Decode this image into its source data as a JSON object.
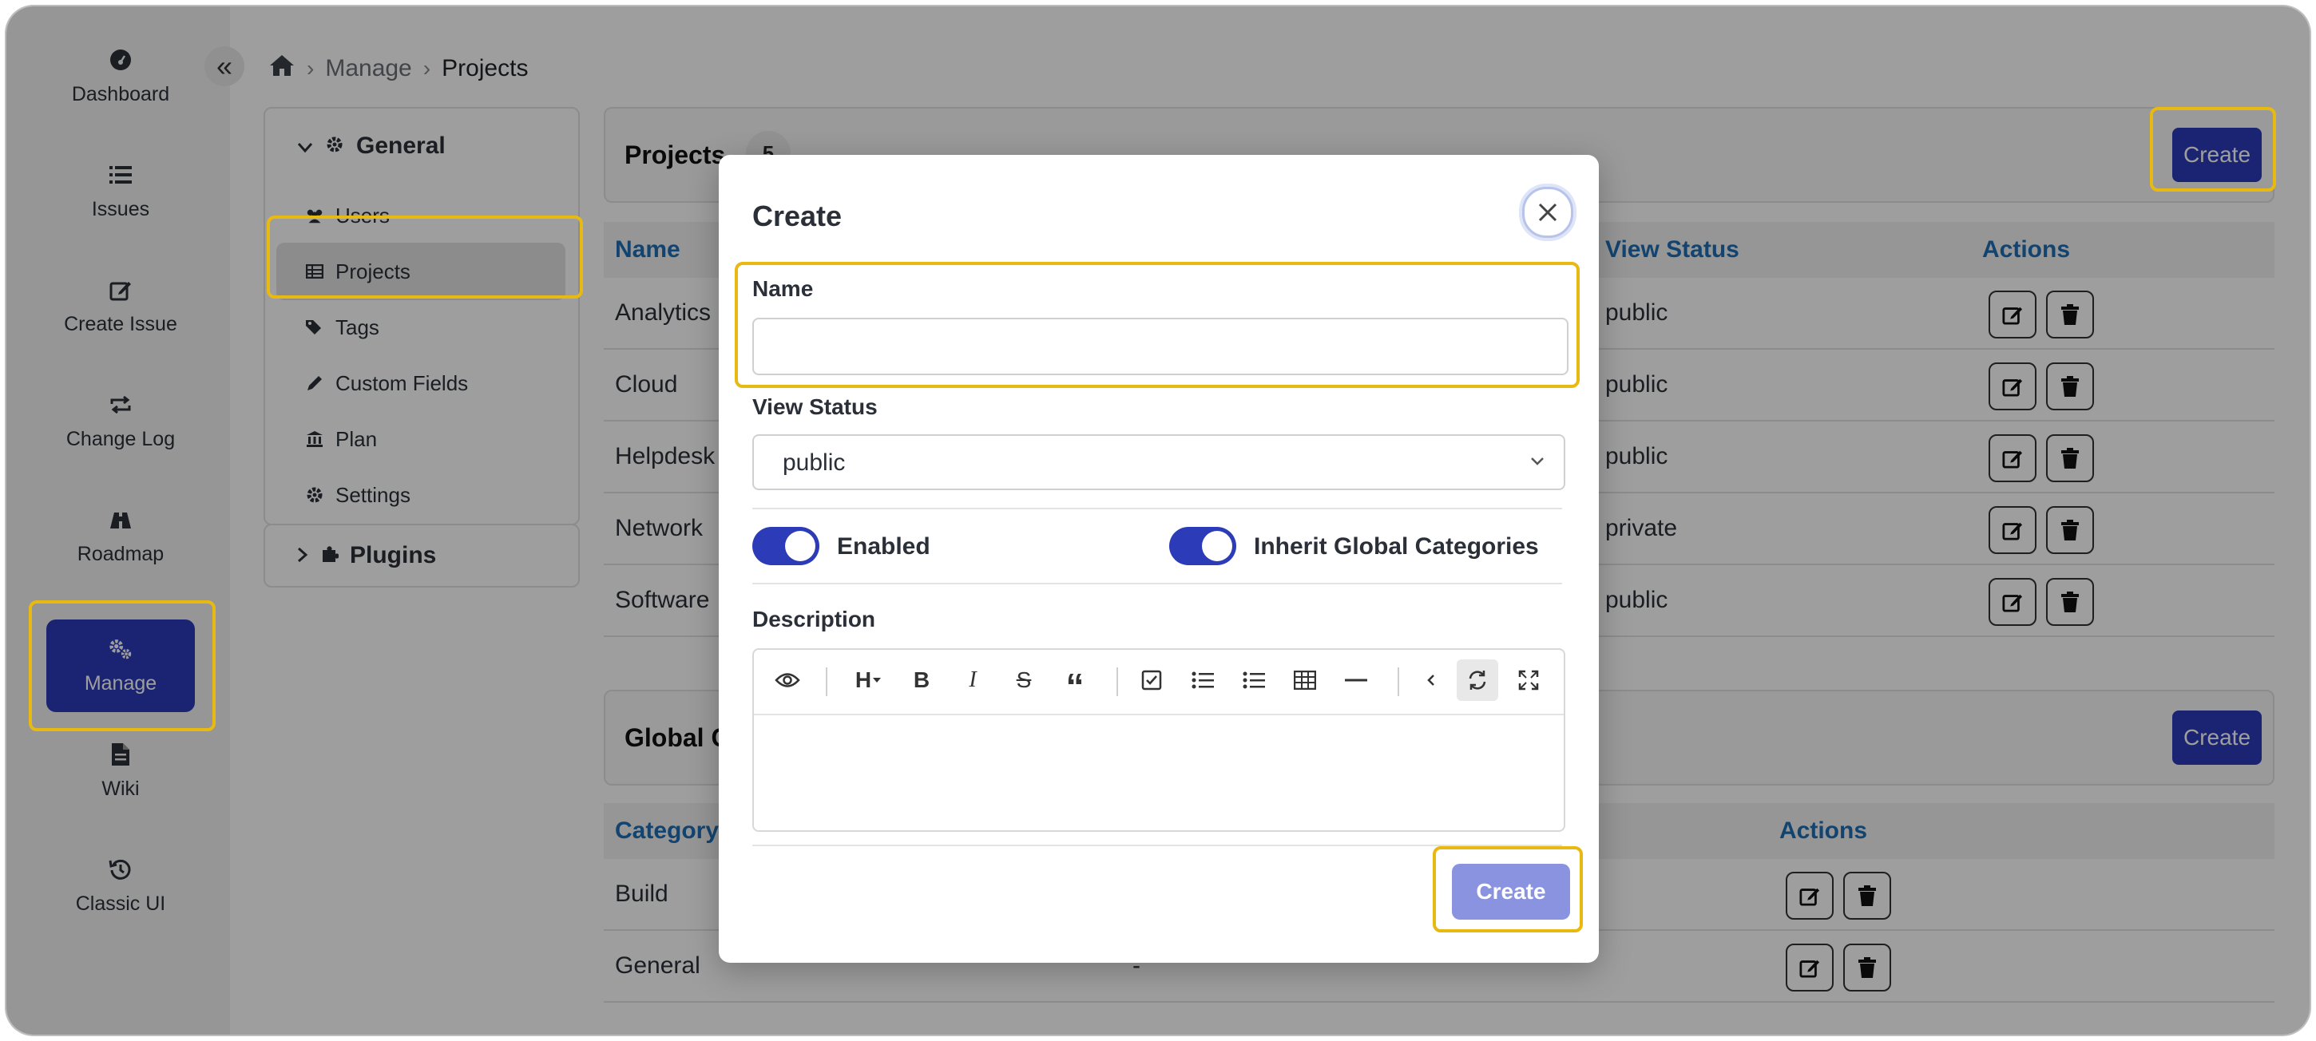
{
  "sidebar": {
    "collapse_glyph": "«",
    "items": [
      {
        "label": "Dashboard",
        "icon": "dashboard-icon"
      },
      {
        "label": "Issues",
        "icon": "list-icon"
      },
      {
        "label": "Create Issue",
        "icon": "edit-icon"
      },
      {
        "label": "Change Log",
        "icon": "repeat-icon"
      },
      {
        "label": "Roadmap",
        "icon": "binoculars-icon"
      },
      {
        "label": "Manage",
        "icon": "gears-icon",
        "active": true
      },
      {
        "label": "Wiki",
        "icon": "file-icon"
      },
      {
        "label": "Classic UI",
        "icon": "history-icon"
      }
    ]
  },
  "breadcrumb": {
    "home_icon": "home-icon",
    "items": [
      "Manage",
      "Projects"
    ]
  },
  "settings_menu": {
    "general_label": "General",
    "items": [
      {
        "label": "Users",
        "icon": "users-icon"
      },
      {
        "label": "Projects",
        "icon": "table-icon",
        "active": true
      },
      {
        "label": "Tags",
        "icon": "tags-icon"
      },
      {
        "label": "Custom Fields",
        "icon": "pencil-icon"
      },
      {
        "label": "Plan",
        "icon": "bank-icon"
      },
      {
        "label": "Settings",
        "icon": "gear-icon"
      }
    ],
    "plugins_label": "Plugins"
  },
  "projects_panel": {
    "title": "Projects",
    "count": "5",
    "create_label": "Create",
    "columns": [
      "Name",
      "View Status",
      "Actions"
    ],
    "rows": [
      {
        "name": "Analytics",
        "view_status": "public"
      },
      {
        "name": "Cloud",
        "view_status": "public"
      },
      {
        "name": "Helpdesk",
        "view_status": "public"
      },
      {
        "name": "Network",
        "view_status": "private"
      },
      {
        "name": "Software",
        "view_status": "public"
      }
    ]
  },
  "categories_panel": {
    "title": "Global C",
    "create_label": "Create",
    "columns": [
      "Category",
      "Actions"
    ],
    "rows": [
      {
        "name": "Build",
        "value": ""
      },
      {
        "name": "General",
        "value": "-"
      }
    ]
  },
  "modal": {
    "title": "Create",
    "name_label": "Name",
    "name_value": "",
    "view_status_label": "View Status",
    "view_status_value": "public",
    "enabled_label": "Enabled",
    "enabled_on": true,
    "inherit_label": "Inherit Global Categories",
    "inherit_on": true,
    "description_label": "Description",
    "heading_glyph": "H",
    "bold_glyph": "B",
    "italic_glyph": "I",
    "strike_glyph": "S",
    "quote_glyph": "“",
    "submit_label": "Create"
  },
  "colors": {
    "accent": "#2c3bb8",
    "header_link": "#1f6fb5",
    "highlight": "#e8b911",
    "submit_disabled": "#8a93e0"
  }
}
